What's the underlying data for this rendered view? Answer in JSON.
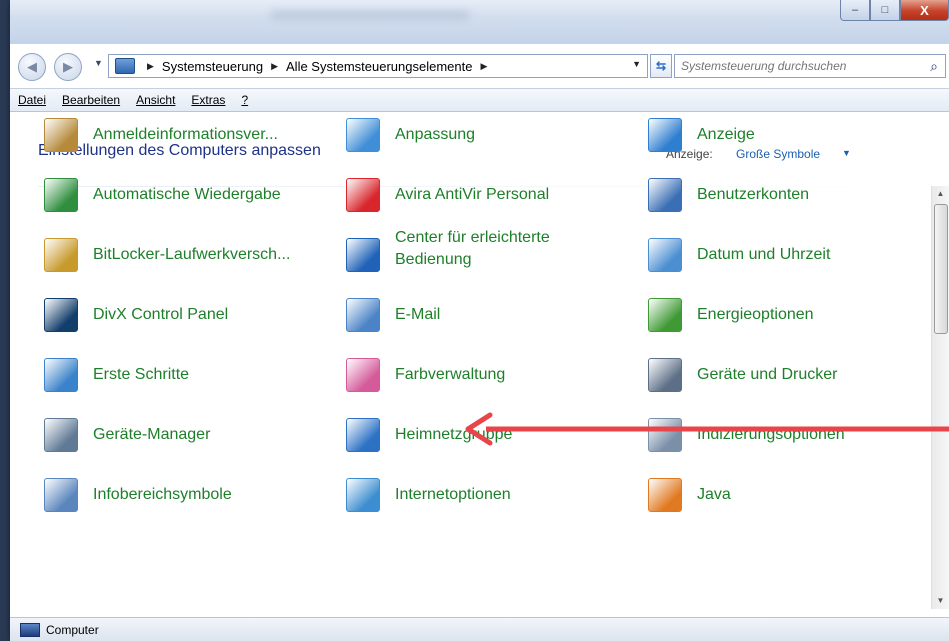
{
  "window": {
    "buttons": {
      "minimize": "–",
      "maximize": "□",
      "close": "X"
    }
  },
  "nav": {
    "back_glyph": "◀",
    "forward_glyph": "▶",
    "breadcrumb": [
      "Systemsteuerung",
      "Alle Systemsteuerungselemente"
    ],
    "search_placeholder": "Systemsteuerung durchsuchen"
  },
  "menu": [
    "Datei",
    "Bearbeiten",
    "Ansicht",
    "Extras",
    "?"
  ],
  "header": {
    "title": "Einstellungen des Computers anpassen",
    "view_label": "Anzeige:",
    "view_value": "Große Symbole"
  },
  "items": [
    {
      "label": "Anmeldeinformationsver...",
      "icon": "credential-vault-icon",
      "color": "#b58a3a"
    },
    {
      "label": "Anpassung",
      "icon": "personalization-icon",
      "color": "#3f8ed6"
    },
    {
      "label": "Anzeige",
      "icon": "display-icon",
      "color": "#2f7fd0"
    },
    {
      "label": "Automatische Wiedergabe",
      "icon": "autoplay-icon",
      "color": "#2f8f3f"
    },
    {
      "label": "Avira AntiVir Personal",
      "icon": "avira-icon",
      "color": "#d8262c"
    },
    {
      "label": "Benutzerkonten",
      "icon": "user-accounts-icon",
      "color": "#3b6fb5"
    },
    {
      "label": "BitLocker-Laufwerkversch...",
      "icon": "bitlocker-icon",
      "color": "#c79a2c"
    },
    {
      "label": "Center für erleichterte Bedienung",
      "icon": "ease-of-access-icon",
      "color": "#1f62b8"
    },
    {
      "label": "Datum und Uhrzeit",
      "icon": "date-time-icon",
      "color": "#4b8fd1"
    },
    {
      "label": "DivX Control Panel",
      "icon": "divx-icon",
      "color": "#123e6b"
    },
    {
      "label": "E-Mail",
      "icon": "email-icon",
      "color": "#4a84c6"
    },
    {
      "label": "Energieoptionen",
      "icon": "power-options-icon",
      "color": "#3f9a35"
    },
    {
      "label": "Erste Schritte",
      "icon": "getting-started-icon",
      "color": "#3a82c9"
    },
    {
      "label": "Farbverwaltung",
      "icon": "color-management-icon",
      "color": "#d45a9a"
    },
    {
      "label": "Geräte und Drucker",
      "icon": "devices-printers-icon",
      "color": "#5d6f87"
    },
    {
      "label": "Geräte-Manager",
      "icon": "device-manager-icon",
      "color": "#607a96"
    },
    {
      "label": "Heimnetzgruppe",
      "icon": "homegroup-icon",
      "color": "#2c71c4"
    },
    {
      "label": "Indizierungsoptionen",
      "icon": "indexing-icon",
      "color": "#7a8fa8"
    },
    {
      "label": "Infobereichsymbole",
      "icon": "notification-area-icon",
      "color": "#5a86bd"
    },
    {
      "label": "Internetoptionen",
      "icon": "internet-options-icon",
      "color": "#3d8ed0"
    },
    {
      "label": "Java",
      "icon": "java-icon",
      "color": "#e07a22"
    }
  ],
  "annotation": {
    "color": "#e8444a"
  },
  "status": {
    "text": "Computer"
  }
}
